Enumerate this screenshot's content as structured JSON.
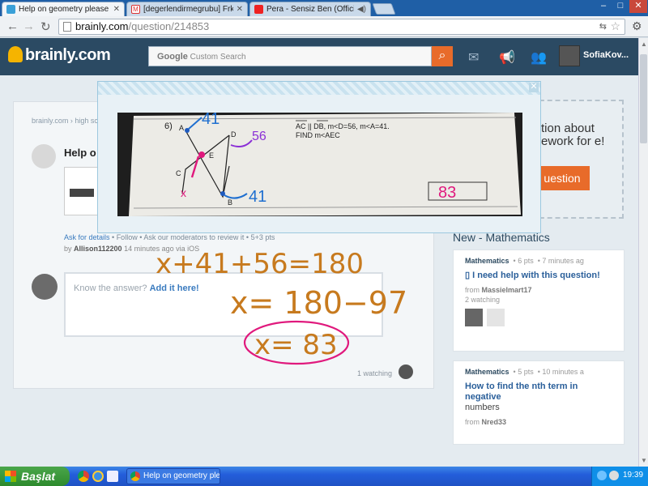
{
  "browser": {
    "tabs": [
      {
        "label": "Help on geometry please sh",
        "active": true,
        "icon": "brainly-icon"
      },
      {
        "label": "[degerlendirmegrubu] Frkanl",
        "active": false,
        "icon": "gmail-icon"
      },
      {
        "label": "Pera - Sensiz Ben (Officia",
        "active": false,
        "icon": "youtube-icon"
      }
    ],
    "url_domain": "brainly.com",
    "url_path": "/question/214853",
    "window_controls": [
      "–",
      "□",
      "✕"
    ]
  },
  "site": {
    "logo": "brainly.com",
    "search_brand": "Google",
    "search_placeholder": "Custom Search",
    "username": "SofiaKov..."
  },
  "question": {
    "breadcrumb": "brainly.com › high sc",
    "title": "Help o",
    "actions": [
      "Ask for details",
      "Follow",
      "Ask our moderators to review it",
      "5+3 pts"
    ],
    "author": "Allison112200",
    "time": "14 minutes ago via iOS",
    "answer_prompt": "Know the answer?",
    "answer_link": "Add it here!",
    "watching": "1 watching"
  },
  "ask_panel": {
    "text": "tion about ework for e!",
    "button": "uestion"
  },
  "new_section": {
    "title": "New - Mathematics",
    "items": [
      {
        "subject": "Mathematics",
        "pts": "6 pts",
        "time": "7 minutes ag",
        "title": "I need help with this question!",
        "from_label": "from",
        "author": "Massielmart17",
        "watching": "2 watching"
      },
      {
        "subject": "Mathematics",
        "pts": "5 pts",
        "time": "10 minutes a",
        "title_bold": "How to find the nth term in negative",
        "title_rest": "numbers",
        "from_label": "from",
        "author": "Nred33"
      }
    ]
  },
  "modal_image": {
    "problem_number": "6)",
    "problem_line1": "AC || DB, m<D=56, m<A=41.",
    "problem_line2": "FIND m<AEC",
    "labels": {
      "a": "A",
      "b": "B",
      "c": "C",
      "d": "D",
      "e": "E"
    },
    "angle_a": "41",
    "angle_d": "56",
    "angle_b": "41",
    "marker_x": "x",
    "answer": "83"
  },
  "handwriting": {
    "line1": "x+41+56=180",
    "line2": "x= 180−97",
    "line3": "x= 83"
  },
  "taskbar": {
    "start": "Başlat",
    "task": "Help on geometry ple...",
    "clock": "19:39"
  }
}
